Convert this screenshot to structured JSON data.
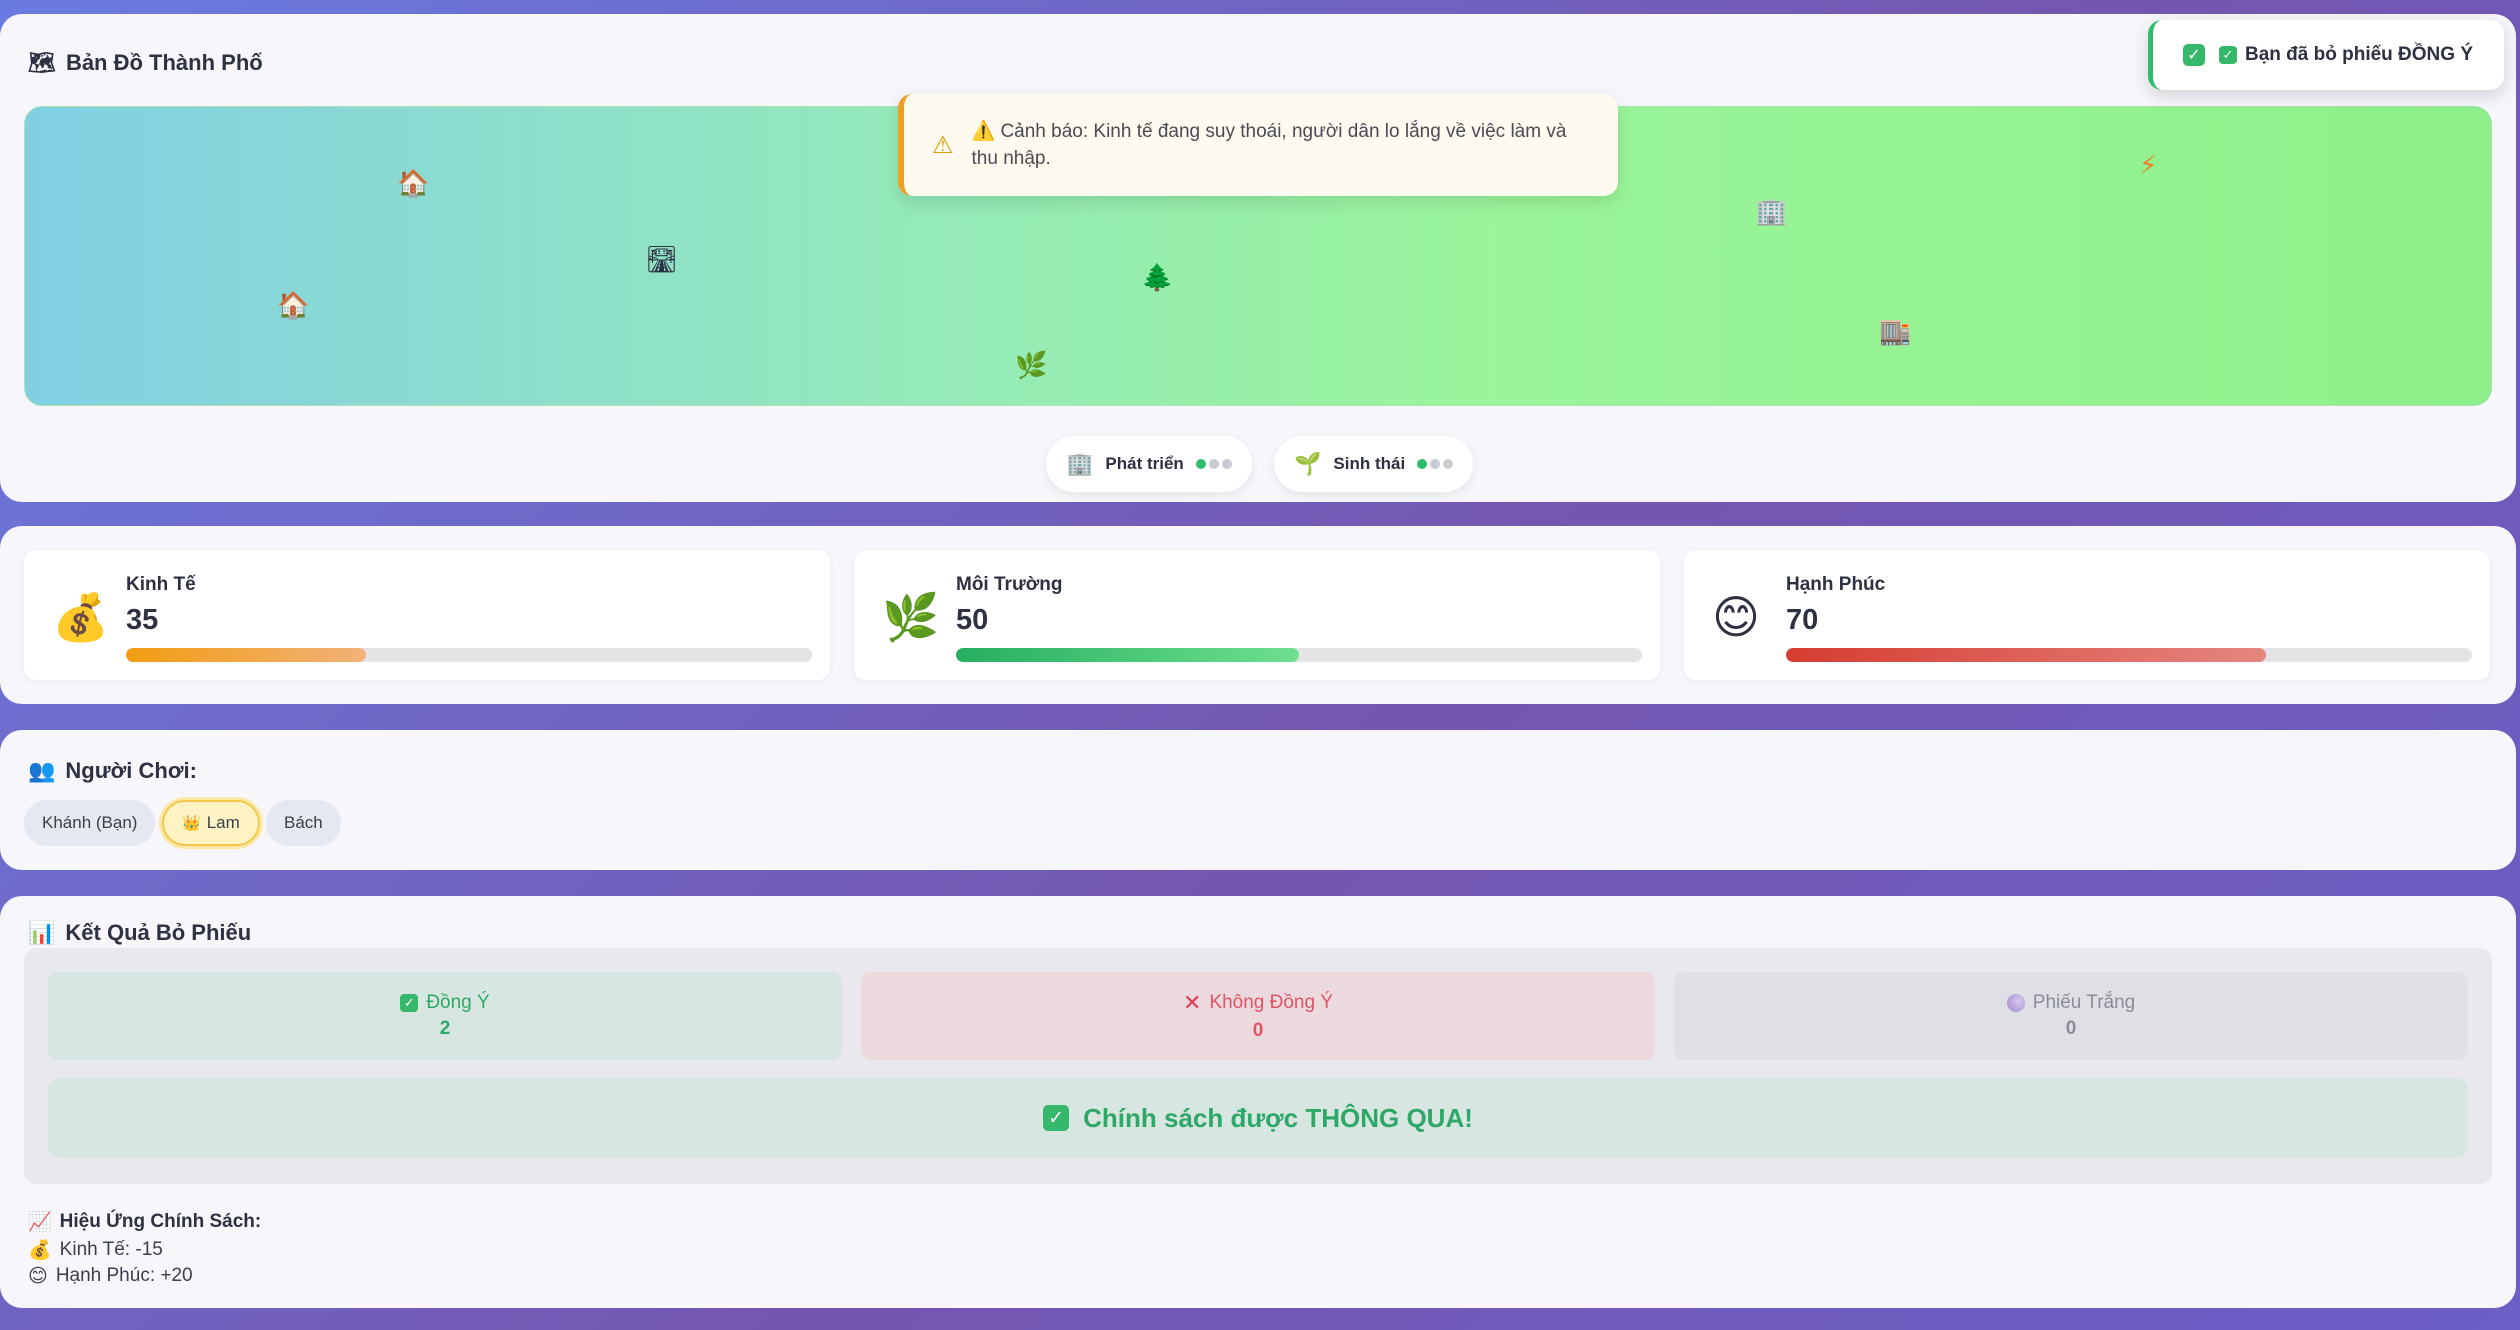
{
  "map_panel": {
    "title_icon": "map-icon",
    "title": "Bản Đồ Thành Phố",
    "map_items": [
      {
        "name": "house-icon",
        "glyph": "🏠"
      },
      {
        "name": "house-icon",
        "glyph": "🏠"
      },
      {
        "name": "road-icon",
        "glyph": "🛣"
      },
      {
        "name": "tree-icon",
        "glyph": "🌲"
      },
      {
        "name": "herb-icon",
        "glyph": "🌿"
      },
      {
        "name": "office-building-icon",
        "glyph": "🏢"
      },
      {
        "name": "building-icon",
        "glyph": "🏬"
      },
      {
        "name": "lightning-icon",
        "glyph": "⚡"
      }
    ],
    "alert": {
      "icon": "warning-icon",
      "text": "⚠️ Cảnh báo: Kinh tế đang suy thoái, người dân lo lắng về việc làm và thu nhập."
    },
    "indicators": [
      {
        "icon": "office-building-icon",
        "label": "Phát triển",
        "level": 1,
        "max": 3
      },
      {
        "icon": "seedling-icon",
        "label": "Sinh thái",
        "level": 1,
        "max": 3
      }
    ]
  },
  "toast": {
    "icon": "check-icon",
    "text": "Bạn đã bỏ phiếu ĐỒNG Ý"
  },
  "stats": [
    {
      "label": "Kinh Tế",
      "value": "35",
      "percent": 35,
      "icon": "money-bag-icon",
      "color_from": "#f39c12",
      "color_to": "#f0b27a"
    },
    {
      "label": "Môi Trường",
      "value": "50",
      "percent": 50,
      "icon": "herb-icon",
      "color_from": "#27ae60",
      "color_to": "#6ee08f"
    },
    {
      "label": "Hạnh Phúc",
      "value": "70",
      "percent": 70,
      "icon": "smiley-icon",
      "color_from": "#d63c30",
      "color_to": "#e58680"
    }
  ],
  "players": {
    "title_icon": "people-icon",
    "title": "Người Chơi:",
    "list": [
      {
        "label": "Khánh (Bạn)",
        "active": false
      },
      {
        "label": "Lam",
        "active": true,
        "icon": "crown-icon"
      },
      {
        "label": "Bách",
        "active": false
      }
    ]
  },
  "results": {
    "title_icon": "bar-chart-icon",
    "title": "Kết Quả Bỏ Phiếu",
    "agree": {
      "label": "Đồng Ý",
      "count": "2"
    },
    "disagree": {
      "label": "Không Đồng Ý",
      "count": "0"
    },
    "blank": {
      "label": "Phiếu Trắng",
      "count": "0"
    },
    "verdict": "Chính sách được THÔNG QUA!",
    "effects_title": "Hiệu Ứng Chính Sách:",
    "effects": [
      {
        "icon": "money-bag-icon",
        "text": "Kinh Tế: -15"
      },
      {
        "icon": "smiley-icon",
        "text": "Hạnh Phúc: +20"
      }
    ]
  },
  "colors": {
    "accent_green": "#2ebd6b",
    "warning": "#f0a020",
    "background_from": "#6a7be0",
    "background_to": "#7456b0"
  }
}
